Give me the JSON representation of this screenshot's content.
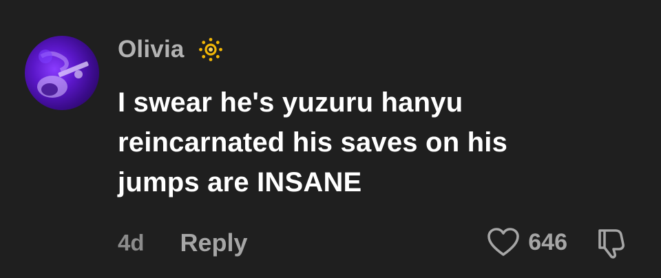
{
  "comment": {
    "username": "Olivia",
    "badge_icon": "sun-icon",
    "text_lines": [
      "I swear he's yuzuru hanyu",
      "reincarnated his saves on his",
      "jumps are INSANE"
    ],
    "timestamp": "4d",
    "reply_label": "Reply",
    "like_count": "646",
    "colors": {
      "background": "#1f1f1f",
      "username": "#b3b3b3",
      "text": "#ffffff",
      "muted": "#a6a6a6",
      "sun": "#f2b705",
      "avatar": "#5b17c9"
    }
  }
}
